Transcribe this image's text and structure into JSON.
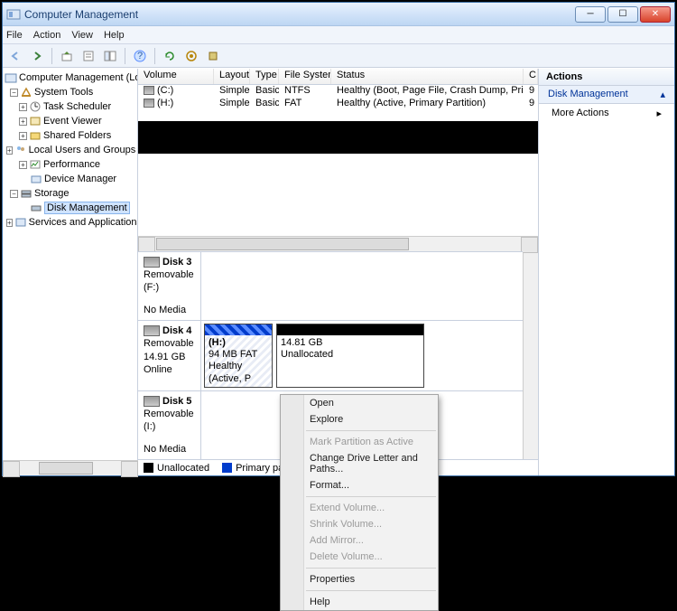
{
  "window": {
    "title": "Computer Management"
  },
  "menus": {
    "file": "File",
    "action": "Action",
    "view": "View",
    "help": "Help"
  },
  "tree": {
    "root": "Computer Management (Local",
    "systools": "System Tools",
    "task": "Task Scheduler",
    "event": "Event Viewer",
    "shared": "Shared Folders",
    "localusers": "Local Users and Groups",
    "perf": "Performance",
    "devmgr": "Device Manager",
    "storage": "Storage",
    "diskmgmt": "Disk Management",
    "services": "Services and Applications"
  },
  "columns": {
    "volume": "Volume",
    "layout": "Layout",
    "type": "Type",
    "fs": "File System",
    "status": "Status",
    "c": "C"
  },
  "volumes": [
    {
      "name": "(C:)",
      "layout": "Simple",
      "type": "Basic",
      "fs": "NTFS",
      "status": "Healthy (Boot, Page File, Crash Dump, Primary Partition)",
      "c": "9"
    },
    {
      "name": "(H:)",
      "layout": "Simple",
      "type": "Basic",
      "fs": "FAT",
      "status": "Healthy (Active, Primary Partition)",
      "c": "9"
    }
  ],
  "disks": {
    "d3": {
      "title": "Disk 3",
      "sub": "Removable (F:)",
      "media": "No Media"
    },
    "d4": {
      "title": "Disk 4",
      "sub": "Removable",
      "size": "14.91 GB",
      "state": "Online",
      "p1_name": "(H:)",
      "p1_size": "94 MB FAT",
      "p1_state": "Healthy (Active, P",
      "p2_size": "14.81 GB",
      "p2_state": "Unallocated"
    },
    "d5": {
      "title": "Disk 5",
      "sub": "Removable (I:)",
      "media": "No Media"
    }
  },
  "legend": {
    "unalloc": "Unallocated",
    "primary": "Primary partition"
  },
  "actions": {
    "header": "Actions",
    "section": "Disk Management",
    "more": "More Actions"
  },
  "context": {
    "open": "Open",
    "explore": "Explore",
    "mark": "Mark Partition as Active",
    "change": "Change Drive Letter and Paths...",
    "format": "Format...",
    "extend": "Extend Volume...",
    "shrink": "Shrink Volume...",
    "addmirror": "Add Mirror...",
    "delete": "Delete Volume...",
    "properties": "Properties",
    "help": "Help"
  }
}
